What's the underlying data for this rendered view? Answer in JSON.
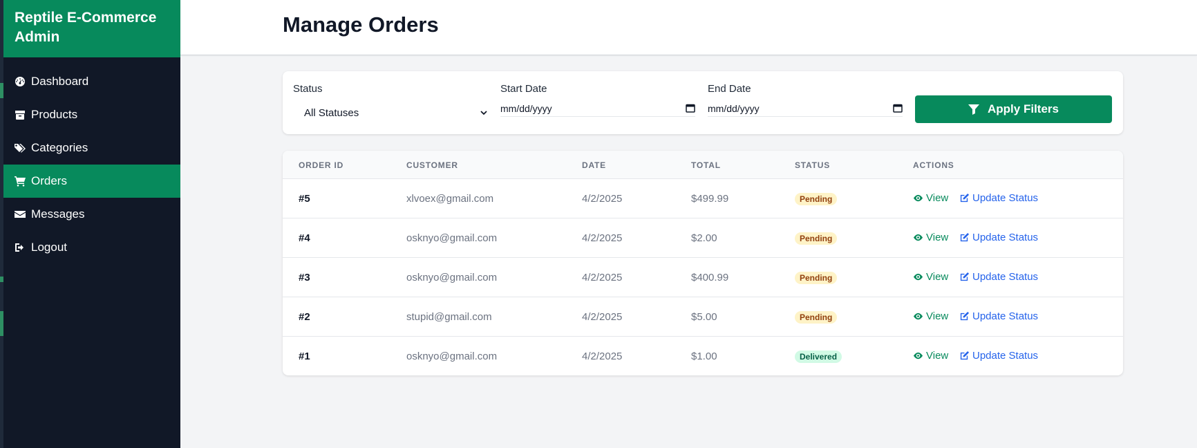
{
  "sidebar": {
    "brand": "Reptile E-Commerce Admin",
    "items": [
      {
        "label": "Dashboard",
        "icon": "dashboard-icon",
        "active": false
      },
      {
        "label": "Products",
        "icon": "box-icon",
        "active": false
      },
      {
        "label": "Categories",
        "icon": "tags-icon",
        "active": false
      },
      {
        "label": "Orders",
        "icon": "cart-icon",
        "active": true
      },
      {
        "label": "Messages",
        "icon": "envelope-icon",
        "active": false
      },
      {
        "label": "Logout",
        "icon": "logout-icon",
        "active": false
      }
    ]
  },
  "header": {
    "title": "Manage Orders"
  },
  "filters": {
    "status_label": "Status",
    "status_value": "All Statuses",
    "start_label": "Start Date",
    "start_placeholder": "mm/dd/yyyy",
    "end_label": "End Date",
    "end_placeholder": "mm/dd/yyyy",
    "apply_label": "Apply Filters"
  },
  "table": {
    "columns": [
      "ORDER ID",
      "CUSTOMER",
      "DATE",
      "TOTAL",
      "STATUS",
      "ACTIONS"
    ],
    "view_label": "View",
    "update_label": "Update Status",
    "rows": [
      {
        "id": "#5",
        "customer": "xlvoex@gmail.com",
        "date": "4/2/2025",
        "total": "$499.99",
        "status": "Pending"
      },
      {
        "id": "#4",
        "customer": "osknyo@gmail.com",
        "date": "4/2/2025",
        "total": "$2.00",
        "status": "Pending"
      },
      {
        "id": "#3",
        "customer": "osknyo@gmail.com",
        "date": "4/2/2025",
        "total": "$400.99",
        "status": "Pending"
      },
      {
        "id": "#2",
        "customer": "stupid@gmail.com",
        "date": "4/2/2025",
        "total": "$5.00",
        "status": "Pending"
      },
      {
        "id": "#1",
        "customer": "osknyo@gmail.com",
        "date": "4/2/2025",
        "total": "$1.00",
        "status": "Delivered"
      }
    ]
  },
  "colors": {
    "brand_green": "#078a5c",
    "sidebar_bg": "#111827",
    "link_blue": "#2563eb",
    "pending_bg": "#fef3c7",
    "delivered_bg": "#d1fae5"
  }
}
